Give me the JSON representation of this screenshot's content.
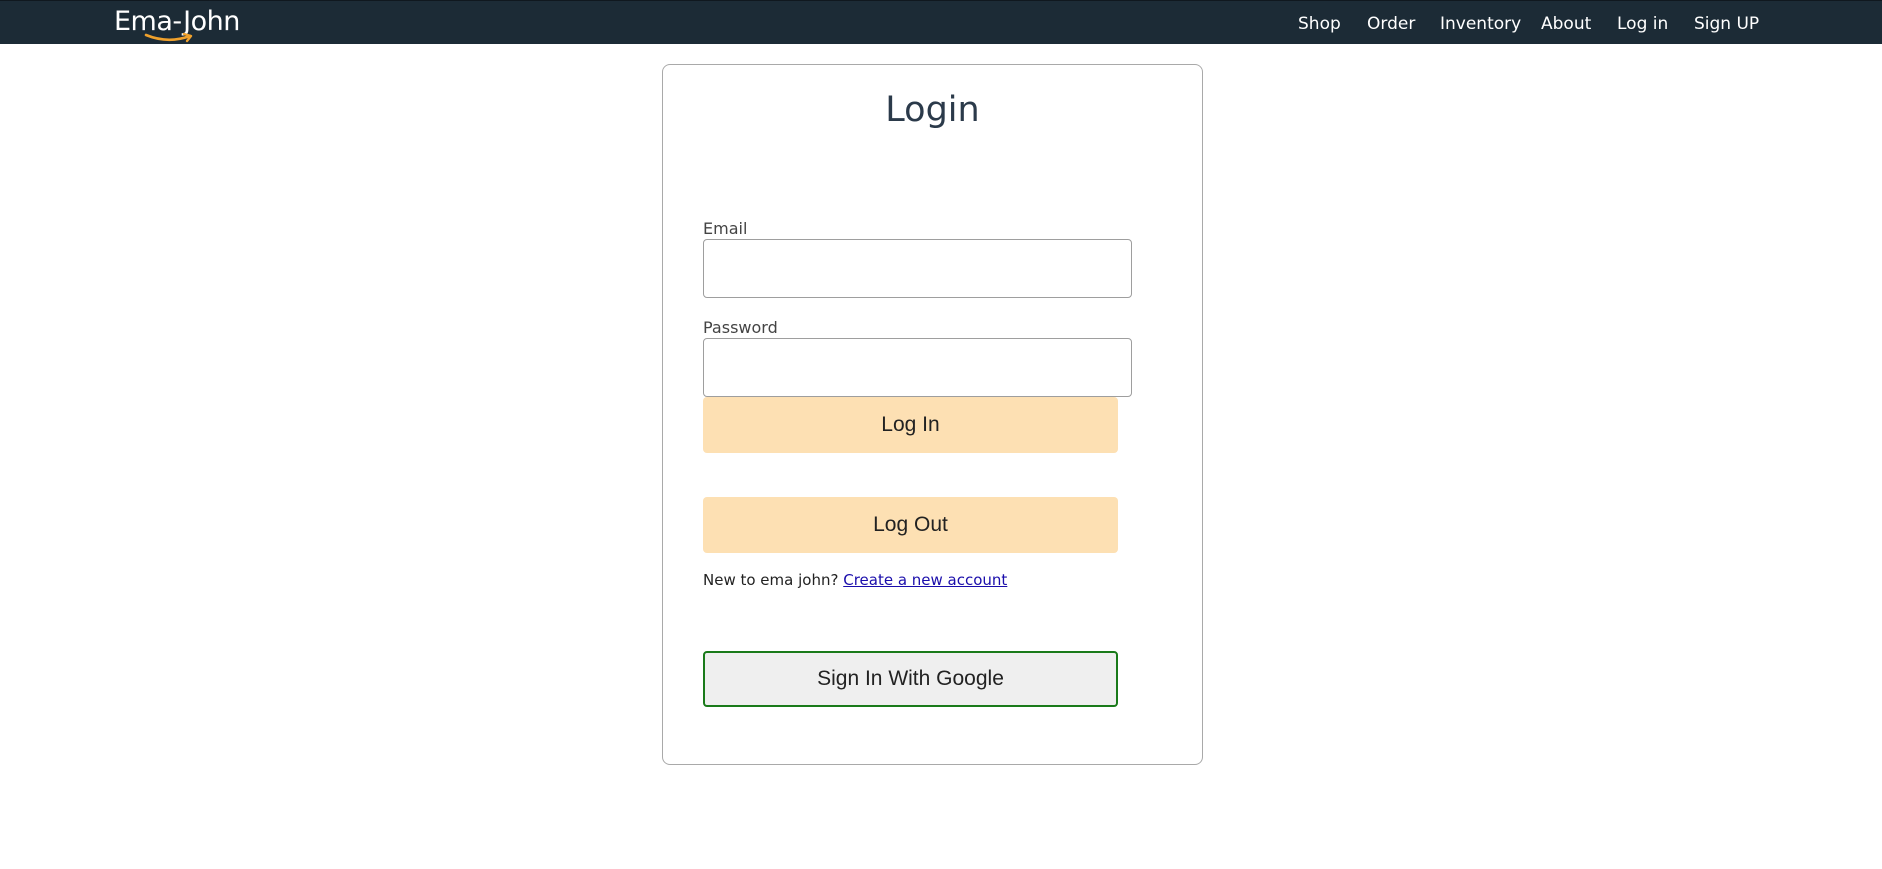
{
  "navbar": {
    "brand": "Ema-John",
    "links": [
      "Shop",
      "Order",
      "Inventory",
      "About",
      "Log in",
      "Sign UP"
    ]
  },
  "login": {
    "title": "Login",
    "email_label": "Email",
    "email_value": "",
    "password_label": "Password",
    "password_value": "",
    "login_button": "Log In",
    "logout_button": "Log Out",
    "new_user_text": "New to ema john?",
    "create_account_link": "Create a new account",
    "google_button": "Sign In With Google"
  },
  "colors": {
    "navbar_bg": "#1c2b36",
    "logo_smile": "#f0a12c",
    "button_bg": "#fde0b3",
    "google_border": "#1a7a1a",
    "link": "#1a0dab"
  },
  "icons": {
    "logo_smile": "amazon-style-smile-arrow"
  }
}
